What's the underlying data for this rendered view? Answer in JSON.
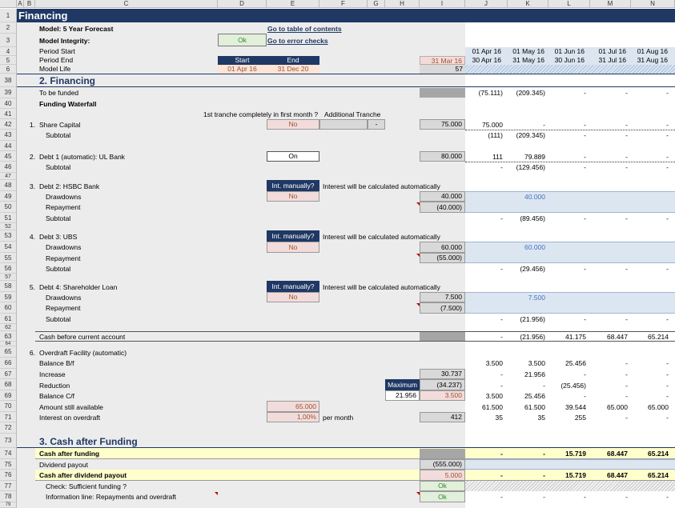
{
  "col_headers": [
    "A",
    "B",
    "C",
    "D",
    "E",
    "F",
    "G",
    "H",
    "I",
    "J",
    "K",
    "L",
    "M",
    "N"
  ],
  "title": "Financing",
  "model_label": "Model: 5 Year Forecast",
  "integrity_label": "Model Integrity:",
  "integrity_status": "Ok",
  "link_toc": "Go to table of contents",
  "link_errors": "Go to error checks",
  "period_start_label": "Period Start",
  "period_end_label": "Period End",
  "model_life_label": "Model Life",
  "start_hdr": "Start",
  "end_hdr": "End",
  "start_date": "01 Apr 16",
  "end_date": "31 Dec 20",
  "i_period_end": "31 Mar 16",
  "i_model_life": "57",
  "period_starts": [
    "01 Apr 16",
    "01 May 16",
    "01 Jun 16",
    "01 Jul 16",
    "01 Aug 16"
  ],
  "period_ends": [
    "30 Apr 16",
    "31 May 16",
    "30 Jun 16",
    "31 Jul 16",
    "31 Aug 16"
  ],
  "rows": {
    "r1": "1",
    "r2": "2",
    "r3": "3",
    "r4": "4",
    "r5": "5",
    "r6": "6",
    "r38": "38",
    "r39": "39",
    "r40": "40",
    "r41": "41",
    "r42": "42",
    "r43": "43",
    "r44": "44",
    "r45": "45",
    "r46": "46",
    "r47": "47",
    "r48": "48",
    "r49": "49",
    "r50": "50",
    "r51": "51",
    "r52": "52",
    "r53": "53",
    "r54": "54",
    "r55": "55",
    "r56": "56",
    "r57": "57",
    "r58": "58",
    "r59": "59",
    "r60": "60",
    "r61": "61",
    "r62": "62",
    "r63": "63",
    "r64": "64",
    "r65": "65",
    "r66": "66",
    "r67": "67",
    "r68": "68",
    "r69": "69",
    "r70": "70",
    "r71": "71",
    "r72": "72",
    "r73": "73",
    "r74": "74",
    "r75": "75",
    "r76": "76",
    "r77": "77",
    "r78": "78",
    "r79": "79"
  },
  "sec2": "2. Financing",
  "to_be_funded": "To be funded",
  "tbf_vals": [
    "(75.111)",
    "(209.345)",
    "-",
    "-",
    "-"
  ],
  "waterfall": "Funding Waterfall",
  "tranche_q": "1st tranche completely in first month ?",
  "additional_tranche": "Additional Tranche",
  "n1": "1.",
  "share_capital": "Share Capital",
  "sc_flag": "No",
  "sc_add": "-",
  "sc_i": "75.000",
  "sc_vals": [
    "75.000",
    "-",
    "-",
    "-",
    "-"
  ],
  "subtotal": "Subtotal",
  "sub1_vals": [
    "(111)",
    "(209.345)",
    "-",
    "-",
    "-"
  ],
  "n2": "2.",
  "debt1": "Debt 1 (automatic): UL Bank",
  "debt1_flag": "On",
  "debt1_i": "80.000",
  "debt1_vals": [
    "111",
    "79.889",
    "-",
    "-",
    "-"
  ],
  "sub2_vals": [
    "-",
    "(129.456)",
    "-",
    "-",
    "-"
  ],
  "n3": "3.",
  "debt2": "Debt 2: HSBC Bank",
  "int_manually": "Int. manually?",
  "no": "No",
  "int_auto": "Interest will be calculated automatically",
  "drawdowns": "Drawdowns",
  "repayment": "Repayment",
  "d2_draw_i": "40.000",
  "d2_draw_k": "40.000",
  "d2_rep_i": "(40.000)",
  "sub3_vals": [
    "-",
    "(89.456)",
    "-",
    "-",
    "-"
  ],
  "n4": "4.",
  "debt3": "Debt 3: UBS",
  "d3_draw_i": "60.000",
  "d3_draw_k": "60.000",
  "d3_rep_i": "(55.000)",
  "sub4_vals": [
    "-",
    "(29.456)",
    "-",
    "-",
    "-"
  ],
  "n5": "5.",
  "debt4": "Debt 4: Shareholder Loan",
  "d4_draw_i": "7.500",
  "d4_draw_k": "7.500",
  "d4_rep_i": "(7.500)",
  "sub5_vals": [
    "-",
    "(21.956)",
    "-",
    "-",
    "-"
  ],
  "cash_before": "Cash before current account",
  "cash_before_vals": [
    "-",
    "(21.956)",
    "41.175",
    "68.447",
    "65.214"
  ],
  "n6": "6.",
  "overdraft": "Overdraft Facility (automatic)",
  "bal_bf": "Balance B/f",
  "bal_bf_vals": [
    "3.500",
    "3.500",
    "25.456",
    "-",
    "-"
  ],
  "increase": "Increase",
  "inc_i": "30.737",
  "inc_vals": [
    "-",
    "21.956",
    "-",
    "-",
    "-"
  ],
  "reduction": "Reduction",
  "maximum": "Maximum",
  "red_i": "(34.237)",
  "red_vals": [
    "-",
    "-",
    "(25.456)",
    "-",
    "-"
  ],
  "bal_cf": "Balance C/f",
  "bal_cf_h": "21.956",
  "bal_cf_i": "3.500",
  "bal_cf_vals": [
    "3.500",
    "25.456",
    "-",
    "-",
    "-"
  ],
  "amount_avail": "Amount still available",
  "avail_e": "65.000",
  "avail_vals": [
    "61.500",
    "61.500",
    "39.544",
    "65.000",
    "65.000"
  ],
  "interest_od": "Interest on overdraft",
  "int_e": "1,00%",
  "per_month": "per month",
  "int_i": "412",
  "int_vals": [
    "35",
    "35",
    "255",
    "-",
    "-"
  ],
  "sec3": "3. Cash after Funding",
  "cash_after": "Cash after funding",
  "cash_after_vals": [
    "-",
    "-",
    "15.719",
    "68.447",
    "65.214"
  ],
  "div_payout": "Dividend payout",
  "div_i": "(555.000)",
  "cash_after_div": "Cash after dividend payout",
  "cad_i": "5.000",
  "cad_vals": [
    "-",
    "-",
    "15.719",
    "68.447",
    "65.214"
  ],
  "check_label": "Check: Sufficient funding ?",
  "check_i": "Ok",
  "info_line": "Information line: Repayments and overdraft",
  "info_i": "Ok",
  "info_vals": [
    "-",
    "-",
    "-",
    "-",
    "-"
  ]
}
